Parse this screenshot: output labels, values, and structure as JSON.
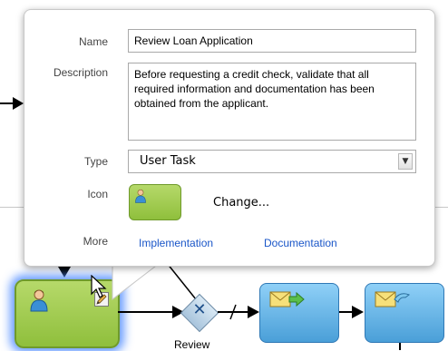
{
  "popup": {
    "name_label": "Name",
    "name_value": "Review Loan Application",
    "description_label": "Description",
    "description_value": "Before requesting a credit check, validate that all required information and documentation has been obtained from the applicant.",
    "type_label": "Type",
    "type_value": "User Task",
    "icon_label": "Icon",
    "icon_name": "user-task-icon",
    "change_label": "Change...",
    "more_label": "More",
    "implementation_label": "Implementation",
    "documentation_label": "Documentation"
  },
  "canvas": {
    "gateway_label": "Review",
    "selected_task_icon": "person-icon",
    "edit_icon": "pencil-icon",
    "task_icons": [
      "send-envelope-icon",
      "receive-envelope-icon"
    ],
    "colors": {
      "user_task_fill": "#9fcb4f",
      "service_task_fill": "#6ab6eb",
      "selection_glow": "#5090ff",
      "link": "#1a56c8"
    }
  }
}
